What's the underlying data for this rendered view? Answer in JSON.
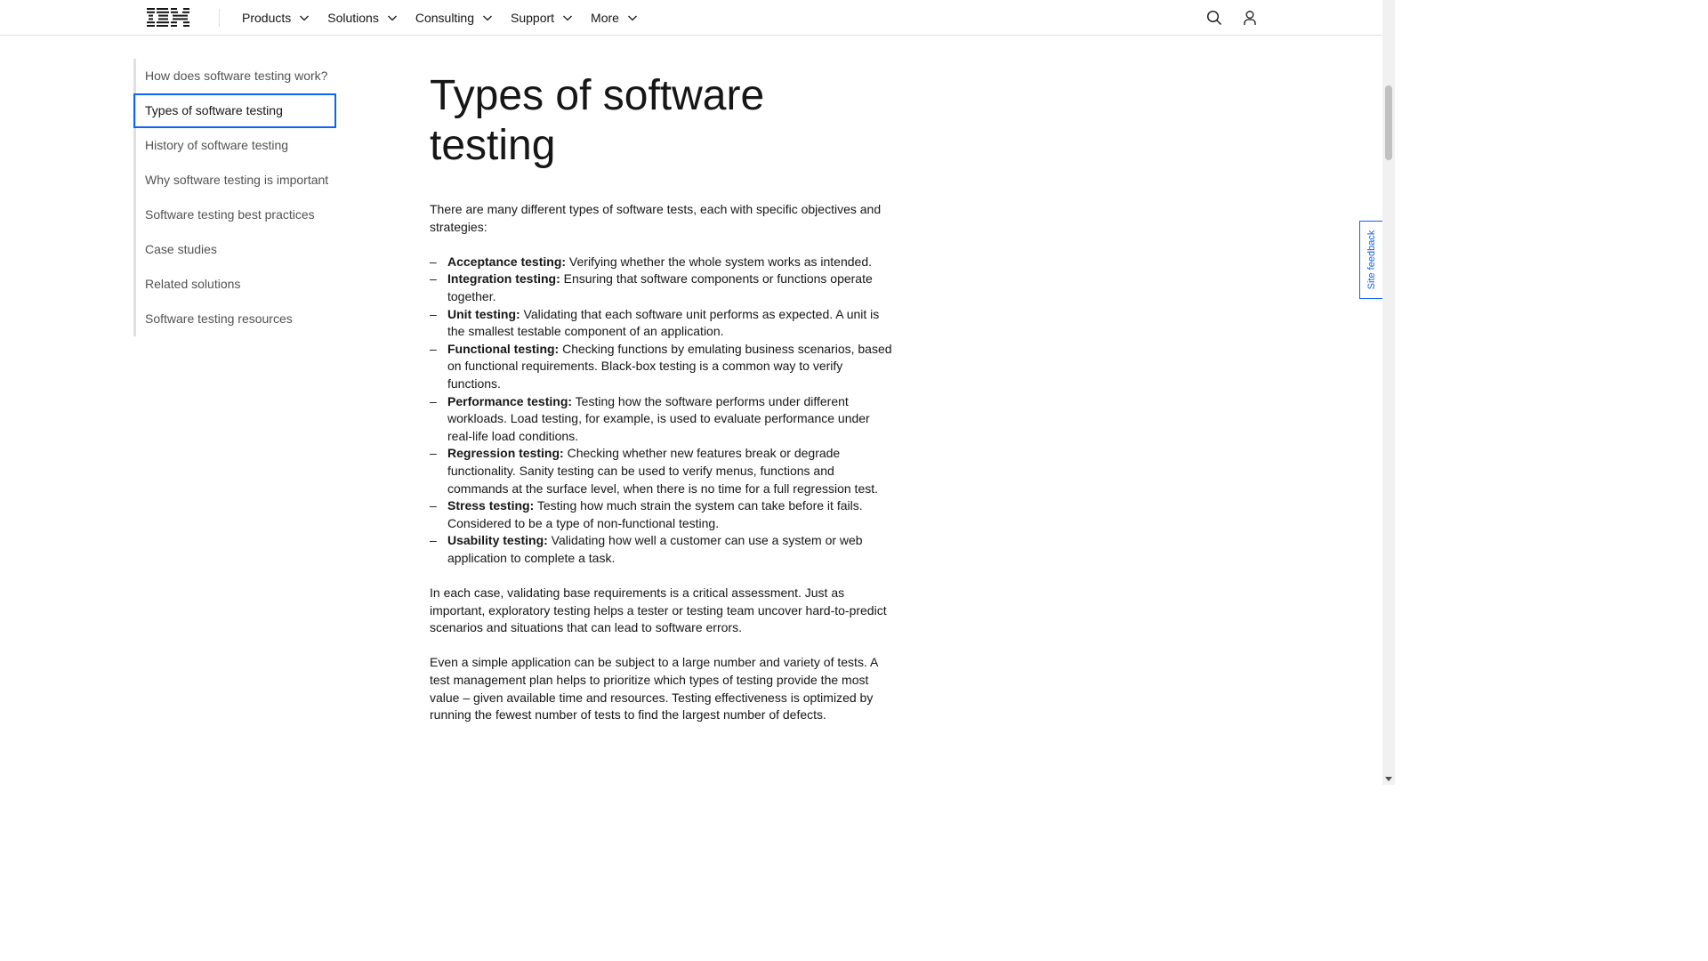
{
  "header": {
    "logo_text": "IBM",
    "nav": [
      {
        "label": "Products"
      },
      {
        "label": "Solutions"
      },
      {
        "label": "Consulting"
      },
      {
        "label": "Support"
      },
      {
        "label": "More"
      }
    ],
    "icons": [
      "search-icon",
      "user-icon",
      "chevron-down-icon"
    ]
  },
  "toc": {
    "items": [
      {
        "label": "How does software testing work?"
      },
      {
        "label": "Types of software testing"
      },
      {
        "label": "History of software testing"
      },
      {
        "label": "Why software testing is important"
      },
      {
        "label": "Software testing best practices"
      },
      {
        "label": "Case studies"
      },
      {
        "label": "Related solutions"
      },
      {
        "label": "Software testing resources"
      }
    ],
    "active_index": 1
  },
  "article": {
    "title_line1": "Types of software",
    "title_line2": "testing",
    "intro": "There are many different types of software tests, each with specific objectives and strategies:",
    "dash": "–",
    "bullets": [
      {
        "term": "Acceptance testing:",
        "text": " Verifying whether the whole system works as intended."
      },
      {
        "term": "Integration testing:",
        "text": " Ensuring that software components or functions operate together."
      },
      {
        "term": "Unit testing:",
        "text": " Validating that each software unit performs as expected. A unit is the smallest testable component of an application."
      },
      {
        "term": "Functional testing:",
        "text": " Checking functions by emulating business scenarios, based on functional requirements. Black-box testing is a common way to verify functions."
      },
      {
        "term": "Performance testing:",
        "text": " Testing how the software performs under different workloads. Load testing, for example, is used to evaluate performance under real-life load conditions."
      },
      {
        "term": "Regression testing:",
        "text": " Checking whether new features break or degrade functionality. Sanity testing can be used to verify menus, functions and commands at the surface level, when there is no time for a full regression test."
      },
      {
        "term": "Stress testing:",
        "text": " Testing how much strain the system can take before it fails. Considered to be a type of non-functional testing."
      },
      {
        "term": "Usability testing:",
        "text": " Validating how well a customer can use a system or web application to complete a task."
      }
    ],
    "para2": "In each case, validating base requirements is a critical assessment. Just as important, exploratory testing helps a tester or testing team uncover hard-to-predict scenarios and situations that can lead to software errors.",
    "para3": "Even a simple application can be subject to a large number and variety of tests. A test management plan helps to prioritize which types of testing provide the most value – given available time and resources. Testing effectiveness is optimized by running the fewest number of tests to find the largest number of defects."
  },
  "feedback": {
    "label": "Site feedback"
  },
  "colors": {
    "accent": "#0f62fe",
    "text": "#161616",
    "muted": "#525252",
    "border": "#e0e0e0"
  }
}
